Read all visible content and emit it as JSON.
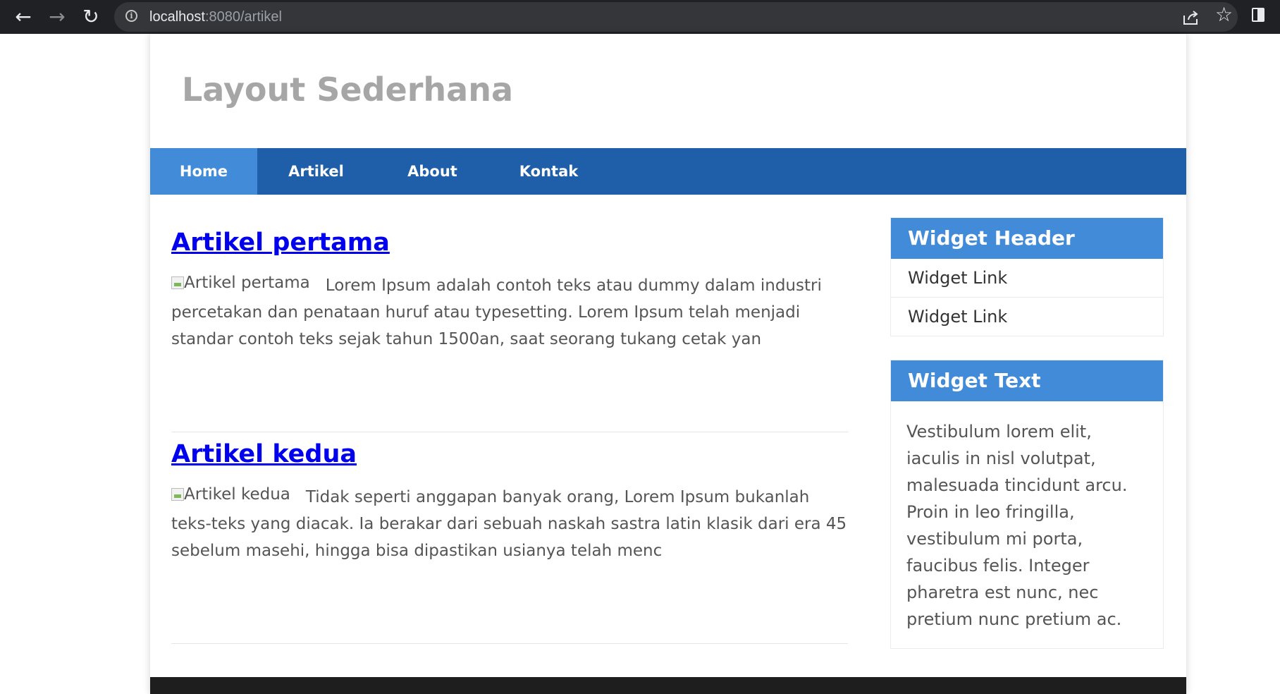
{
  "browser": {
    "url_host": "localhost",
    "url_path": ":8080/artikel"
  },
  "site": {
    "title": "Layout Sederhana"
  },
  "nav": {
    "items": [
      {
        "label": "Home",
        "active": true
      },
      {
        "label": "Artikel",
        "active": false
      },
      {
        "label": "About",
        "active": false
      },
      {
        "label": "Kontak",
        "active": false
      }
    ]
  },
  "articles": [
    {
      "title": "Artikel pertama",
      "image_alt": "Artikel pertama",
      "excerpt": "Lorem Ipsum adalah contoh teks atau dummy dalam industri percetakan dan penataan huruf atau typesetting. Lorem Ipsum telah menjadi standar contoh teks sejak tahun 1500an, saat seorang tukang cetak yan"
    },
    {
      "title": "Artikel kedua",
      "image_alt": "Artikel kedua",
      "excerpt": "Tidak seperti anggapan banyak orang, Lorem Ipsum bukanlah teks-teks yang diacak. Ia berakar dari sebuah naskah sastra latin klasik dari era 45 sebelum masehi, hingga bisa dipastikan usianya telah menc"
    }
  ],
  "sidebar": {
    "widget_links": {
      "header": "Widget Header",
      "links": [
        "Widget Link",
        "Widget Link"
      ]
    },
    "widget_text": {
      "header": "Widget Text",
      "body": "Vestibulum lorem elit, iaculis in nisl volutpat, malesuada tincidunt arcu. Proin in leo fringilla, vestibulum mi porta, faucibus felis. Integer pharetra est nunc, nec pretium nunc pretium ac."
    }
  },
  "colors": {
    "nav_bg": "#1f5faa",
    "nav_active": "#428bd9",
    "widget_header": "#428bd9",
    "link": "#0000ee",
    "title_gray": "#a6a6a6"
  }
}
